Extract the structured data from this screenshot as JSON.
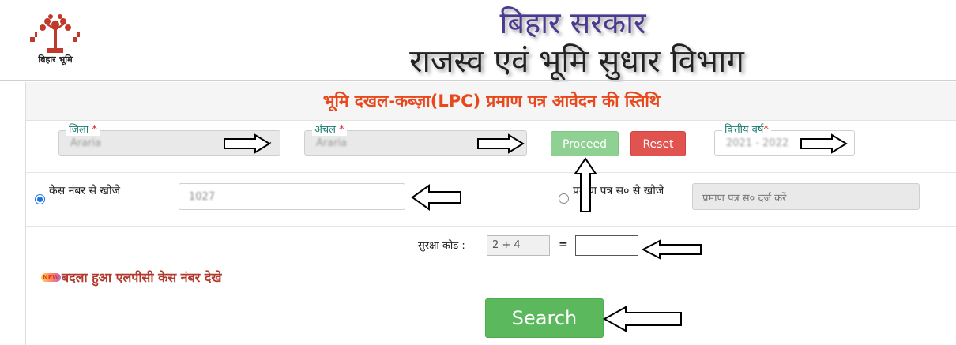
{
  "header": {
    "logo_caption": "बिहार भूमि",
    "title_line1": "बिहार सरकार",
    "title_line2": "राजस्व एवं भूमि सुधार विभाग"
  },
  "form": {
    "title": "भूमि दखल-कब्ज़ा(LPC) प्रमाण पत्र आवेदन की स्तिथि",
    "district": {
      "label": "जिला",
      "required_mark": "*",
      "value": "Araria"
    },
    "circle": {
      "label": "अंचल",
      "required_mark": "*",
      "value": "Araria"
    },
    "proceed_label": "Proceed",
    "reset_label": "Reset",
    "financial_year": {
      "label": "वित्तीय वर्ष",
      "required_mark": "*",
      "value": "2021 - 2022"
    },
    "search_by_case": {
      "label": "केस नंबर से खोजे",
      "value": "1027",
      "selected": true
    },
    "search_by_certificate": {
      "label": "प्रमाण पत्र स० से खोजे",
      "placeholder": "प्रमाण पत्र स० दर्ज करें",
      "selected": false
    },
    "captcha": {
      "label": "सुरक्षा कोड :",
      "question": "2 + 4",
      "equals": "=",
      "answer": ""
    },
    "changed_case_link": "बदला हुआ एलपीसी केस नंबर देखे",
    "new_badge": "NEW",
    "search_label": "Search"
  },
  "colors": {
    "title_accent": "#e8481c",
    "label_teal": "#1a7a6e",
    "proceed_bg": "#8fd193",
    "reset_bg": "#e0534f",
    "search_bg": "#5cb85c",
    "link": "#b03a2e"
  }
}
